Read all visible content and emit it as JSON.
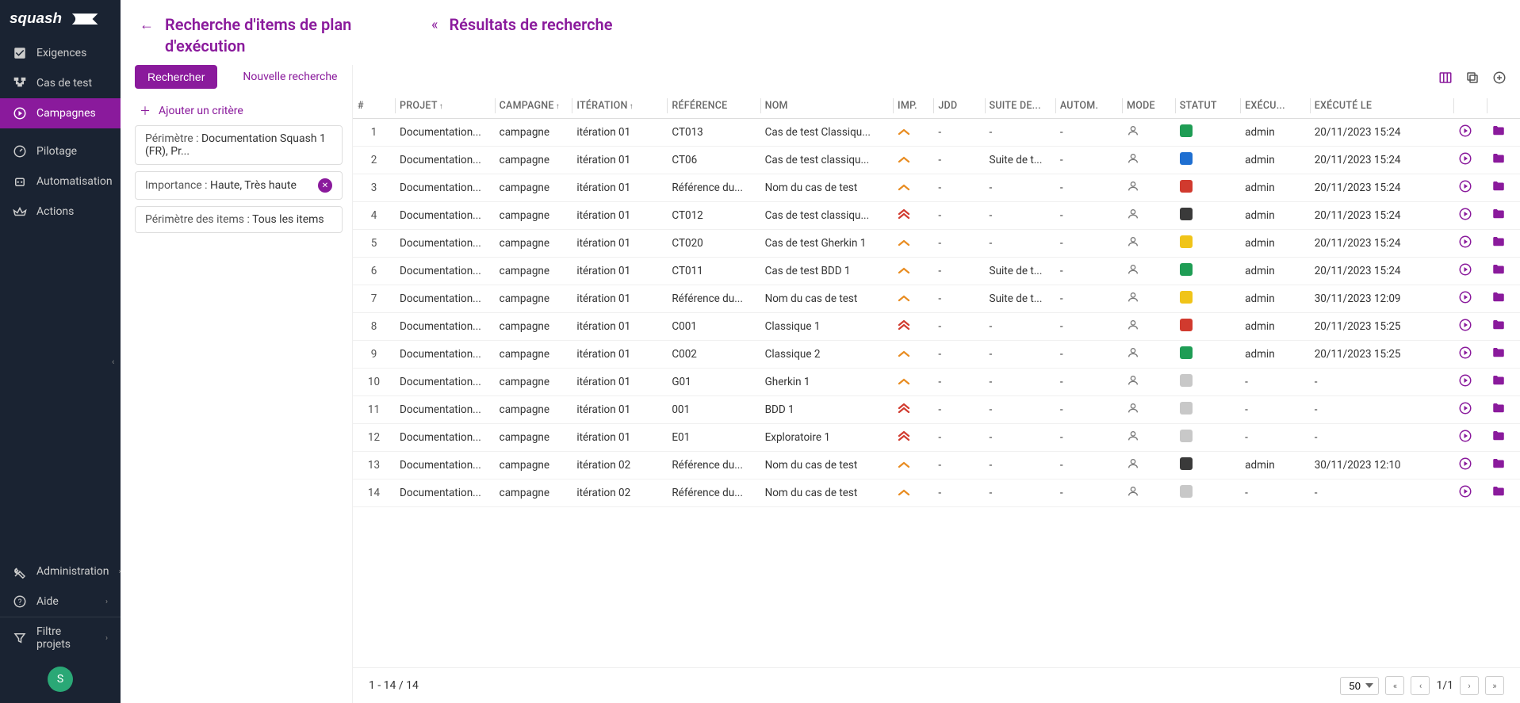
{
  "sidebar": {
    "items": [
      {
        "label": "Exigences"
      },
      {
        "label": "Cas de test"
      },
      {
        "label": "Campagnes"
      },
      {
        "label": "Pilotage"
      },
      {
        "label": "Automatisation"
      },
      {
        "label": "Actions"
      }
    ],
    "footer": [
      {
        "label": "Administration"
      },
      {
        "label": "Aide"
      },
      {
        "label": "Filtre projets"
      }
    ],
    "avatar": "S"
  },
  "header": {
    "title1": "Recherche d'items de plan d'exécution",
    "title2": "Résultats de recherche"
  },
  "filter": {
    "tab_search": "Rechercher",
    "tab_new": "Nouvelle recherche",
    "add_crit": "Ajouter un critère",
    "c1_label": "Périmètre : ",
    "c1_value": "Documentation Squash 1 (FR), Pr...",
    "c2_label": "Importance : ",
    "c2_value": "Haute, Très haute",
    "c3_label": "Périmètre des items : ",
    "c3_value": "Tous les items"
  },
  "columns": {
    "num": "#",
    "projet": "PROJET",
    "campagne": "CAMPAGNE",
    "iteration": "ITÉRATION",
    "reference": "RÉFÉRENCE",
    "nom": "NOM",
    "imp": "IMP.",
    "jdd": "JDD",
    "suite": "SUITE DE...",
    "autom": "AUTOM.",
    "mode": "MODE",
    "statut": "STATUT",
    "execu": "EXÉCU...",
    "date": "EXÉCUTÉ LE"
  },
  "status_colors": {
    "green": "#1f9d55",
    "blue": "#1f6fd1",
    "red": "#d13a2e",
    "dark": "#3a3a3a",
    "yellow": "#f0c419",
    "grey": "#c8c8c8"
  },
  "rows": [
    {
      "n": 1,
      "proj": "Documentation...",
      "camp": "campagne",
      "iter": "itération 01",
      "ref": "CT013",
      "nom": "Cas de test Classiqu...",
      "imp": "high",
      "jdd": "-",
      "suite": "-",
      "autom": "-",
      "stat": "green",
      "exec": "admin",
      "date": "20/11/2023 15:24"
    },
    {
      "n": 2,
      "proj": "Documentation...",
      "camp": "campagne",
      "iter": "itération 01",
      "ref": "CT06",
      "nom": "Cas de test classiqu...",
      "imp": "high",
      "jdd": "-",
      "suite": "Suite de t...",
      "autom": "-",
      "stat": "blue",
      "exec": "admin",
      "date": "20/11/2023 15:24"
    },
    {
      "n": 3,
      "proj": "Documentation...",
      "camp": "campagne",
      "iter": "itération 01",
      "ref": "Référence du...",
      "nom": "Nom du cas de test",
      "imp": "high",
      "jdd": "-",
      "suite": "-",
      "autom": "-",
      "stat": "red",
      "exec": "admin",
      "date": "20/11/2023 15:24"
    },
    {
      "n": 4,
      "proj": "Documentation...",
      "camp": "campagne",
      "iter": "itération 01",
      "ref": "CT012",
      "nom": "Cas de test classiqu...",
      "imp": "vhigh",
      "jdd": "-",
      "suite": "-",
      "autom": "-",
      "stat": "dark",
      "exec": "admin",
      "date": "20/11/2023 15:24"
    },
    {
      "n": 5,
      "proj": "Documentation...",
      "camp": "campagne",
      "iter": "itération 01",
      "ref": "CT020",
      "nom": "Cas de test Gherkin 1",
      "imp": "high",
      "jdd": "-",
      "suite": "-",
      "autom": "-",
      "stat": "yellow",
      "exec": "admin",
      "date": "20/11/2023 15:24"
    },
    {
      "n": 6,
      "proj": "Documentation...",
      "camp": "campagne",
      "iter": "itération 01",
      "ref": "CT011",
      "nom": "Cas de test BDD 1",
      "imp": "high",
      "jdd": "-",
      "suite": "Suite de t...",
      "autom": "-",
      "stat": "green",
      "exec": "admin",
      "date": "20/11/2023 15:24"
    },
    {
      "n": 7,
      "proj": "Documentation...",
      "camp": "campagne",
      "iter": "itération 01",
      "ref": "Référence du...",
      "nom": "Nom du cas de test",
      "imp": "high",
      "jdd": "-",
      "suite": "Suite de t...",
      "autom": "-",
      "stat": "yellow",
      "exec": "admin",
      "date": "30/11/2023 12:09"
    },
    {
      "n": 8,
      "proj": "Documentation...",
      "camp": "campagne",
      "iter": "itération 01",
      "ref": "C001",
      "nom": "Classique 1",
      "imp": "vhigh",
      "jdd": "-",
      "suite": "-",
      "autom": "-",
      "stat": "red",
      "exec": "admin",
      "date": "20/11/2023 15:25"
    },
    {
      "n": 9,
      "proj": "Documentation...",
      "camp": "campagne",
      "iter": "itération 01",
      "ref": "C002",
      "nom": "Classique 2",
      "imp": "high",
      "jdd": "-",
      "suite": "-",
      "autom": "-",
      "stat": "green",
      "exec": "admin",
      "date": "20/11/2023 15:25"
    },
    {
      "n": 10,
      "proj": "Documentation...",
      "camp": "campagne",
      "iter": "itération 01",
      "ref": "G01",
      "nom": "Gherkin 1",
      "imp": "high",
      "jdd": "-",
      "suite": "-",
      "autom": "-",
      "stat": "grey",
      "exec": "-",
      "date": "-"
    },
    {
      "n": 11,
      "proj": "Documentation...",
      "camp": "campagne",
      "iter": "itération 01",
      "ref": "001",
      "nom": "BDD 1",
      "imp": "vhigh",
      "jdd": "-",
      "suite": "-",
      "autom": "-",
      "stat": "grey",
      "exec": "-",
      "date": "-"
    },
    {
      "n": 12,
      "proj": "Documentation...",
      "camp": "campagne",
      "iter": "itération 01",
      "ref": "E01",
      "nom": "Exploratoire 1",
      "imp": "vhigh",
      "jdd": "-",
      "suite": "-",
      "autom": "-",
      "stat": "grey",
      "exec": "-",
      "date": "-"
    },
    {
      "n": 13,
      "proj": "Documentation...",
      "camp": "campagne",
      "iter": "itération 02",
      "ref": "Référence du...",
      "nom": "Nom du cas de test",
      "imp": "high",
      "jdd": "-",
      "suite": "-",
      "autom": "-",
      "stat": "dark",
      "exec": "admin",
      "date": "30/11/2023 12:10"
    },
    {
      "n": 14,
      "proj": "Documentation...",
      "camp": "campagne",
      "iter": "itération 02",
      "ref": "Référence du...",
      "nom": "Nom du cas de test",
      "imp": "high",
      "jdd": "-",
      "suite": "-",
      "autom": "-",
      "stat": "grey",
      "exec": "-",
      "date": "-"
    }
  ],
  "pager": {
    "range": "1 - 14 / 14",
    "page_size": "50",
    "page": "1/1"
  }
}
